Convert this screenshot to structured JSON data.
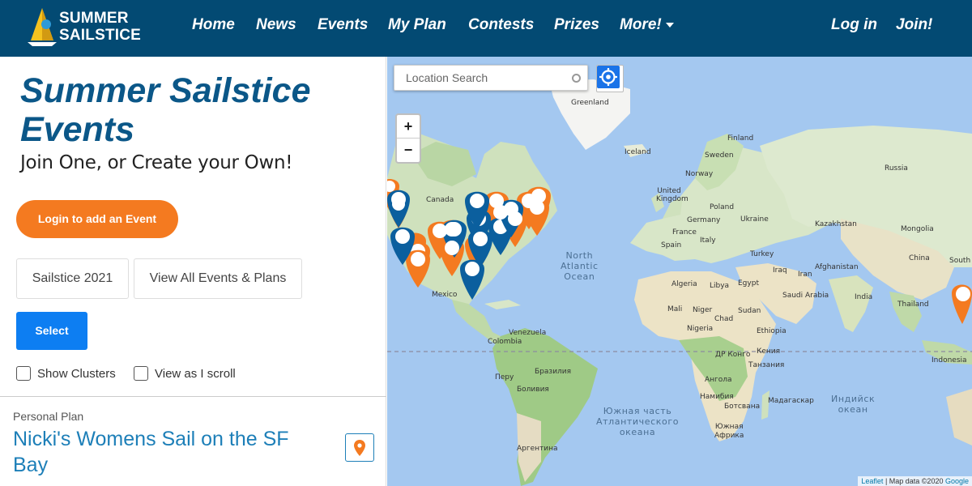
{
  "header": {
    "logo_line1": "SUMMER",
    "logo_line2": "SAILSTICE",
    "nav": [
      "Home",
      "News",
      "Events",
      "My Plan",
      "Contests",
      "Prizes",
      "More!"
    ],
    "login": "Log in",
    "join": "Join!"
  },
  "left": {
    "title": "Summer Sailstice Events",
    "subtitle": "Join One, or Create your Own!",
    "login_button": "Login to add an Event",
    "tab_sailstice": "Sailstice 2021",
    "tab_view_all": "View All Events & Plans",
    "select_button": "Select",
    "show_clusters": "Show Clusters",
    "view_as_scroll": "View as I scroll",
    "plan_label": "Personal Plan",
    "plan_title": "Nicki's Womens Sail on the SF Bay"
  },
  "map": {
    "search_placeholder": "Location Search",
    "zoom_in": "+",
    "zoom_out": "−",
    "labels": {
      "greenland": "Greenland",
      "iceland": "Iceland",
      "finland": "Finland",
      "sweden": "Sweden",
      "norway": "Norway",
      "russia": "Russia",
      "uk": "United Kingdom",
      "poland": "Poland",
      "germany": "Germany",
      "ukraine": "Ukraine",
      "france": "France",
      "kazakhstan": "Kazakhstan",
      "mongolia": "Mongolia",
      "spain": "Spain",
      "italy": "Italy",
      "turkey": "Turkey",
      "afghanistan": "Afghanistan",
      "iraq": "Iraq",
      "iran": "Iran",
      "china": "China",
      "south": "South",
      "algeria": "Algeria",
      "libya": "Libya",
      "egypt": "Egypt",
      "saudi": "Saudi Arabia",
      "india": "India",
      "mali": "Mali",
      "niger": "Niger",
      "sudan": "Sudan",
      "thailand": "Thailand",
      "chad": "Chad",
      "nigeria": "Nigeria",
      "ethiopia": "Ethiopia",
      "drc": "ДР Конго",
      "kenya": "Кения",
      "tanzania": "Танзания",
      "indonesia": "Indonesia",
      "canada": "Canada",
      "mexico": "Mexico",
      "venezuela": "Venezuela",
      "colombia": "Colombia",
      "peru": "Перу",
      "brazil": "Бразилия",
      "bolivia": "Боливия",
      "argentina": "Аргентина",
      "angola": "Ангола",
      "namibia": "Намибия",
      "botswana": "Ботсвана",
      "madagascar": "Мадагаскар",
      "south_africa_1": "Южная",
      "south_africa_2": "Африка"
    },
    "oceans": {
      "north_atlantic_1": "North",
      "north_atlantic_2": "Atlantic",
      "north_atlantic_3": "Ocean",
      "south_atlantic_1": "Южная часть",
      "south_atlantic_2": "Атлантического",
      "south_atlantic_3": "океана",
      "indian_1": "Индийск",
      "indian_2": "океан"
    },
    "attribution_leaflet": "Leaflet",
    "attribution_text": " | Map data ©2020 ",
    "attribution_google": "Google",
    "colors": {
      "orange_pin": "#f47a20",
      "blue_pin": "#0b5f9e",
      "water": "#a4c8f0"
    }
  }
}
